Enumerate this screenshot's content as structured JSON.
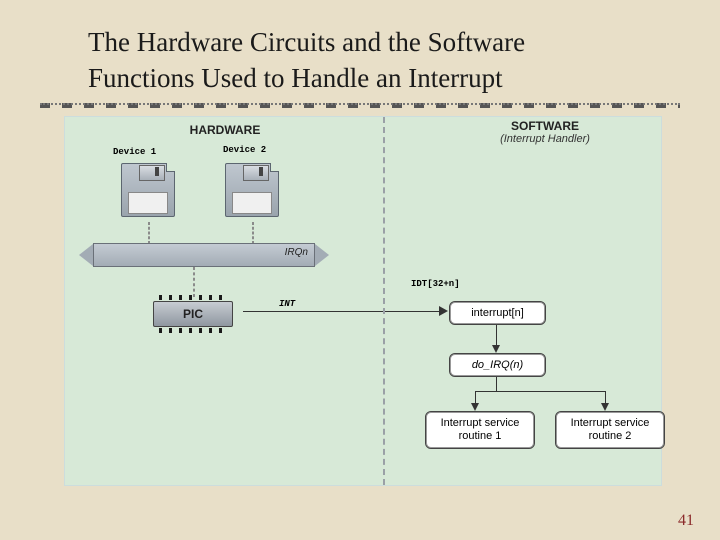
{
  "title_line1": "The Hardware Circuits and the Software",
  "title_line2": "Functions Used to Handle an Interrupt",
  "hardware_header": "HARDWARE",
  "software_header": "SOFTWARE",
  "software_sub": "(Interrupt Handler)",
  "device1": "Device 1",
  "device2": "Device 2",
  "irqn": "IRQn",
  "pic": "PIC",
  "int_label": "INT",
  "idt_label": "IDT[32+n]",
  "sw_boxes": {
    "interrupt_n": "interrupt[n]",
    "do_irq": "do_IRQ(n)",
    "isr1_l1": "Interrupt service",
    "isr1_l2": "routine 1",
    "isr2_l1": "Interrupt service",
    "isr2_l2": "routine 2"
  },
  "slide_number": "41"
}
